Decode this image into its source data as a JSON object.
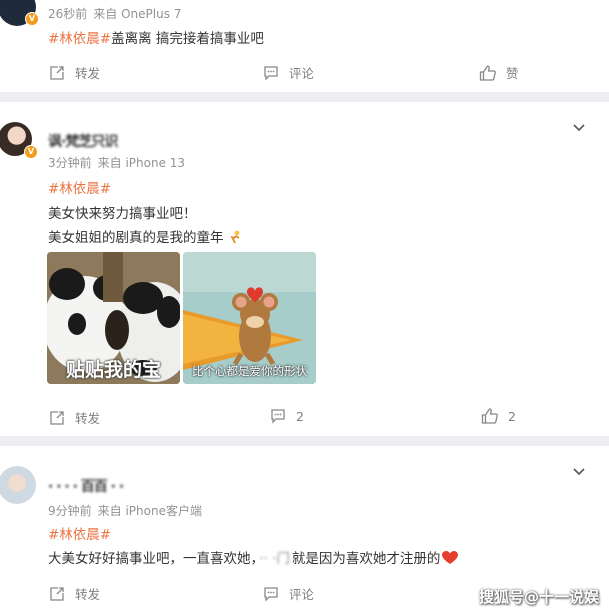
{
  "posts": [
    {
      "time": "26秒前",
      "source": "来自 OnePlus 7",
      "hashtag": "#林依晨#",
      "text": "盖离离 搞完接着搞事业吧",
      "actions": {
        "repost": "转发",
        "comment": "评论",
        "like": "赞"
      }
    },
    {
      "username": "讽·梵芝只识",
      "time": "3分钟前",
      "source": "来自 iPhone 13",
      "hashtag": "#林依晨#",
      "line1": "美女快来努力搞事业吧！",
      "line2": "美女姐姐的剧真的是我的童年",
      "images": [
        {
          "caption": "贴贴我的宝"
        },
        {
          "caption": "比个心都是爱你的形状"
        }
      ],
      "actions": {
        "repost": "转发",
        "comment": "2",
        "like": "2"
      }
    },
    {
      "username": "· · · · 百百 · ·",
      "time": "9分钟前",
      "source": "来自 iPhone客户端",
      "hashtag": "#林依晨#",
      "text_a": "大美女好好搞事业吧，一直喜欢她，",
      "text_b": "·· ·门",
      "text_c": "就是因为喜欢她才注册的",
      "actions": {
        "repost": "转发",
        "comment": "评论"
      }
    }
  ],
  "watermark": "搜狐号@十一说娱",
  "colors": {
    "hashtag": "#eb7340",
    "verified": "#f29b1b",
    "background": "#eceef1"
  }
}
